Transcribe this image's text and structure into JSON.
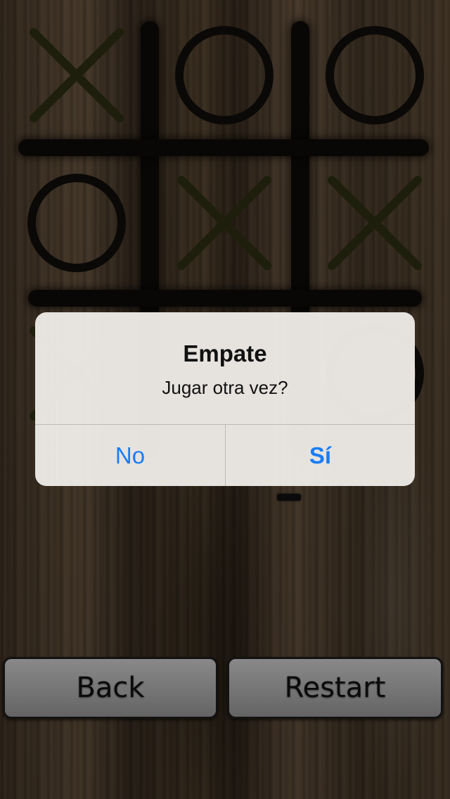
{
  "board": {
    "cells": [
      "X",
      "O",
      "O",
      "O",
      "X",
      "X",
      "X",
      "?",
      "O"
    ]
  },
  "buttons": {
    "back_label": "Back",
    "restart_label": "Restart"
  },
  "alert": {
    "title": "Empate",
    "message": "Jugar otra vez?",
    "cancel_label": "No",
    "confirm_label": "Sí"
  },
  "colors": {
    "x_mark": "#2a2c12",
    "o_mark": "#0f0d0b",
    "alert_button_text": "#1a7cf5"
  }
}
